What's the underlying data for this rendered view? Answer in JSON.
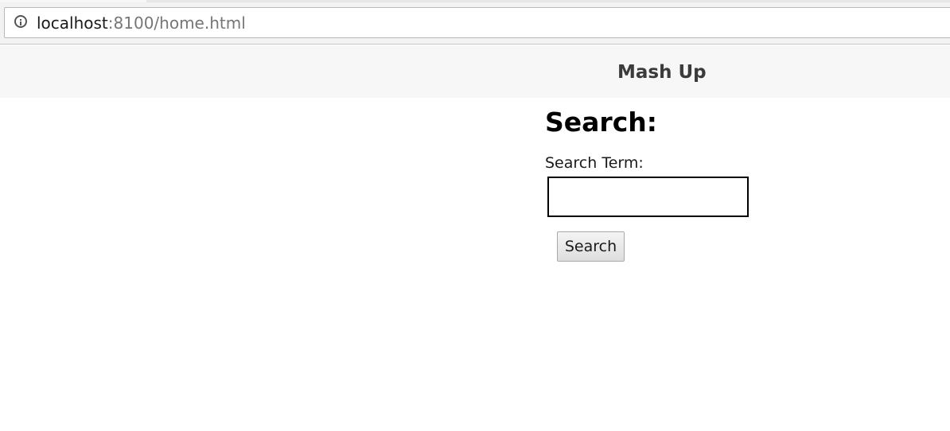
{
  "browser": {
    "url_host": "localhost",
    "url_rest": ":8100/home.html"
  },
  "header": {
    "title": "Mash Up"
  },
  "main": {
    "heading": "Search:",
    "search_label": "Search Term:",
    "search_value": "",
    "search_button_label": "Search"
  },
  "icons": {
    "address_bar": "info-icon"
  }
}
